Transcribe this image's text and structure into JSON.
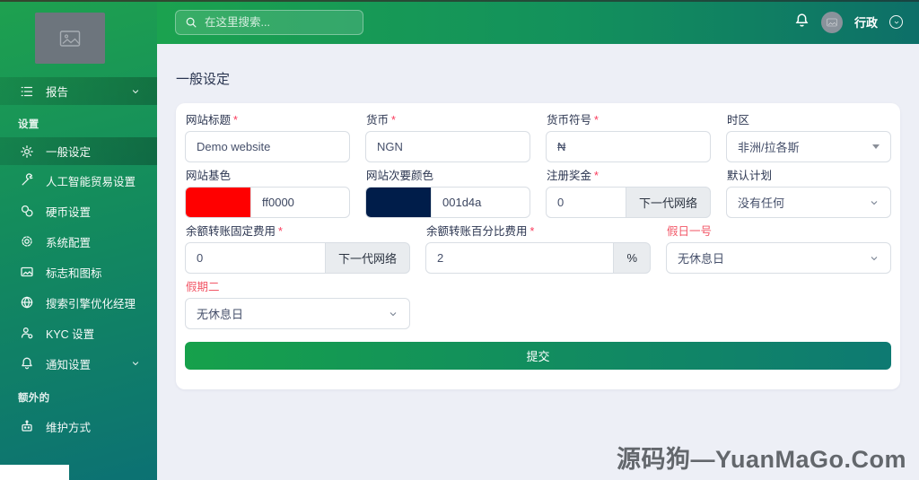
{
  "topbar": {
    "search_placeholder": "在这里搜索...",
    "username": "行政"
  },
  "sidebar": {
    "report_label": "报告",
    "sections": [
      {
        "title": "设置",
        "items": [
          "一般设定",
          "人工智能贸易设置",
          "硬币设置",
          "系统配置",
          "标志和图标",
          "搜索引擎优化经理",
          "KYC 设置",
          "通知设置"
        ]
      },
      {
        "title": "额外的",
        "items": [
          "维护方式"
        ]
      }
    ]
  },
  "page": {
    "title": "一般设定"
  },
  "form": {
    "site_title": {
      "label": "网站标题",
      "req": "*",
      "value": "Demo website"
    },
    "currency": {
      "label": "货币",
      "req": "*",
      "value": "NGN"
    },
    "currency_symbol": {
      "label": "货币符号",
      "req": "*",
      "value": "₦"
    },
    "timezone": {
      "label": "时区",
      "value": "非洲/拉各斯"
    },
    "base_color": {
      "label": "网站基色",
      "swatch": "#ff0000",
      "value": "ff0000"
    },
    "secondary_color": {
      "label": "网站次要颜色",
      "swatch": "#001d4a",
      "value": "001d4a"
    },
    "signup_bonus": {
      "label": "注册奖金",
      "req": "*",
      "value": "0",
      "addon": "下一代网络"
    },
    "default_plan": {
      "label": "默认计划",
      "value": "没有任何"
    },
    "transfer_fixed_fee": {
      "label": "余额转账固定费用",
      "req": "*",
      "value": "0",
      "addon": "下一代网络"
    },
    "transfer_percent_fee": {
      "label": "余额转账百分比费用",
      "req": "*",
      "value": "2",
      "addon": "%"
    },
    "holiday_one": {
      "label": "假日一号",
      "value": "无休息日"
    },
    "holiday_two": {
      "label": "假期二",
      "value": "无休息日"
    },
    "submit_label": "提交"
  },
  "watermark": "源码狗—YuanMaGo.Com",
  "colors": {
    "accent_green": "#18a557",
    "dark_teal": "#0d7377",
    "required_red": "#fa3b5c",
    "danger_label_red": "#f25767",
    "base_color_swatch": "#ff0000",
    "secondary_color_swatch": "#001d4a"
  }
}
